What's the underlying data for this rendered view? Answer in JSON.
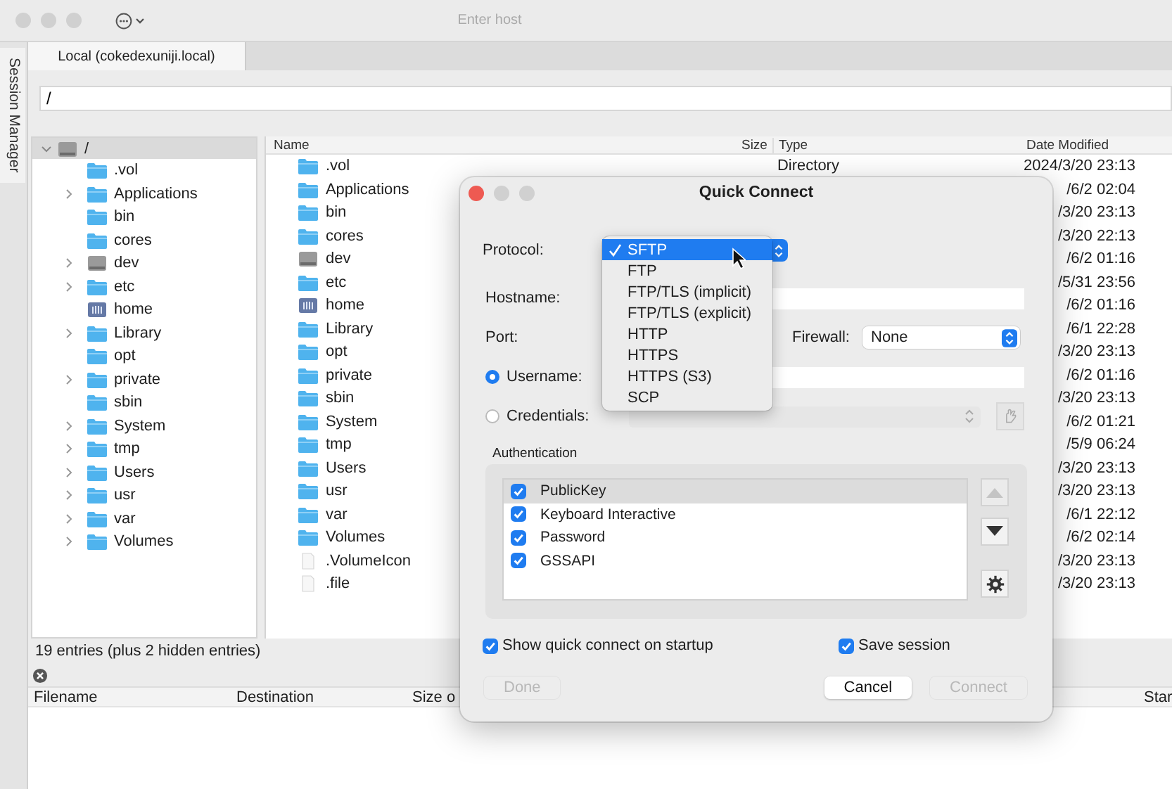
{
  "window": {
    "host_field": {
      "placeholder": "Enter host"
    }
  },
  "sidebar_tab": "Session Manager",
  "tabs": [
    {
      "label": "Local (cokedexuniji.local)",
      "selected": true
    }
  ],
  "path": "/",
  "tree": {
    "label": "/",
    "kind": "disk",
    "expanded": true,
    "selected": true,
    "children": [
      {
        "label": ".vol",
        "kind": "folder",
        "expandable": false
      },
      {
        "label": "Applications",
        "kind": "folder",
        "expandable": true
      },
      {
        "label": "bin",
        "kind": "folder",
        "expandable": false
      },
      {
        "label": "cores",
        "kind": "folder",
        "expandable": false
      },
      {
        "label": "dev",
        "kind": "disk",
        "expandable": true
      },
      {
        "label": "etc",
        "kind": "folder",
        "expandable": true
      },
      {
        "label": "home",
        "kind": "share",
        "expandable": false
      },
      {
        "label": "Library",
        "kind": "folder",
        "expandable": true
      },
      {
        "label": "opt",
        "kind": "folder",
        "expandable": false
      },
      {
        "label": "private",
        "kind": "folder",
        "expandable": true
      },
      {
        "label": "sbin",
        "kind": "folder",
        "expandable": false
      },
      {
        "label": "System",
        "kind": "folder",
        "expandable": true
      },
      {
        "label": "tmp",
        "kind": "folder",
        "expandable": true
      },
      {
        "label": "Users",
        "kind": "folder",
        "expandable": true
      },
      {
        "label": "usr",
        "kind": "folder",
        "expandable": true
      },
      {
        "label": "var",
        "kind": "folder",
        "expandable": true
      },
      {
        "label": "Volumes",
        "kind": "folder",
        "expandable": true
      }
    ]
  },
  "listing": {
    "columns": [
      "Name",
      "Size",
      "Type",
      "Date Modified"
    ],
    "rows": [
      {
        "name": ".vol",
        "kind": "folder",
        "type": "Directory",
        "date": "2024/3/20 23:13"
      },
      {
        "name": "Applications",
        "kind": "folder",
        "date": "/6/2 02:04"
      },
      {
        "name": "bin",
        "kind": "folder",
        "date": "/3/20 23:13"
      },
      {
        "name": "cores",
        "kind": "folder",
        "date": "/3/20 22:13"
      },
      {
        "name": "dev",
        "kind": "disk",
        "date": "/6/2 01:16"
      },
      {
        "name": "etc",
        "kind": "folder",
        "date": "/5/31 23:56"
      },
      {
        "name": "home",
        "kind": "share",
        "date": "/6/2 01:16"
      },
      {
        "name": "Library",
        "kind": "folder",
        "date": "/6/1 22:28"
      },
      {
        "name": "opt",
        "kind": "folder",
        "date": "/3/20 23:13"
      },
      {
        "name": "private",
        "kind": "folder",
        "date": "/6/2 01:16"
      },
      {
        "name": "sbin",
        "kind": "folder",
        "date": "/3/20 23:13"
      },
      {
        "name": "System",
        "kind": "folder",
        "date": "/6/2 01:21"
      },
      {
        "name": "tmp",
        "kind": "folder",
        "date": "/5/9 06:24"
      },
      {
        "name": "Users",
        "kind": "folder",
        "date": "/3/20 23:13"
      },
      {
        "name": "usr",
        "kind": "folder",
        "date": "/3/20 23:13"
      },
      {
        "name": "var",
        "kind": "folder",
        "date": "/6/1 22:12"
      },
      {
        "name": "Volumes",
        "kind": "folder",
        "date": "/6/2 02:14"
      },
      {
        "name": ".VolumeIcon",
        "kind": "file",
        "date": "/3/20 23:13"
      },
      {
        "name": ".file",
        "kind": "file",
        "date": "/3/20 23:13"
      }
    ]
  },
  "status": "19 entries (plus 2 hidden entries)",
  "transfers": {
    "columns": [
      "Filename",
      "Destination",
      "Size o",
      "Star"
    ]
  },
  "dialog": {
    "title": "Quick Connect",
    "protocol": {
      "label": "Protocol:",
      "options": [
        {
          "label": "SFTP",
          "selected": true
        },
        {
          "label": "FTP",
          "selected": false
        },
        {
          "label": "FTP/TLS (implicit)",
          "selected": false
        },
        {
          "label": "FTP/TLS (explicit)",
          "selected": false
        },
        {
          "label": "HTTP",
          "selected": false
        },
        {
          "label": "HTTPS",
          "selected": false
        },
        {
          "label": "HTTPS (S3)",
          "selected": false
        },
        {
          "label": "SCP",
          "selected": false
        }
      ]
    },
    "hostname": {
      "label": "Hostname:"
    },
    "port": {
      "label": "Port:"
    },
    "firewall": {
      "label": "Firewall:",
      "value": "None"
    },
    "login": [
      {
        "label": "Username:",
        "selected": true
      },
      {
        "label": "Credentials:",
        "selected": false
      }
    ],
    "authentication": {
      "label": "Authentication",
      "methods": [
        {
          "label": "PublicKey",
          "checked": true,
          "selected": true
        },
        {
          "label": "Keyboard Interactive",
          "checked": true,
          "selected": false
        },
        {
          "label": "Password",
          "checked": true,
          "selected": false
        },
        {
          "label": "GSSAPI",
          "checked": true,
          "selected": false
        }
      ]
    },
    "reorder": [
      {
        "kind": "up",
        "disabled": true
      },
      {
        "kind": "down",
        "disabled": false
      }
    ],
    "options": [
      {
        "label": "Show quick connect on startup",
        "checked": true
      },
      {
        "label": "Save session",
        "checked": true
      }
    ],
    "buttons": [
      {
        "label": "Done",
        "disabled": true
      },
      {
        "label": "Cancel",
        "disabled": false
      },
      {
        "label": "Connect",
        "disabled": true
      }
    ]
  }
}
